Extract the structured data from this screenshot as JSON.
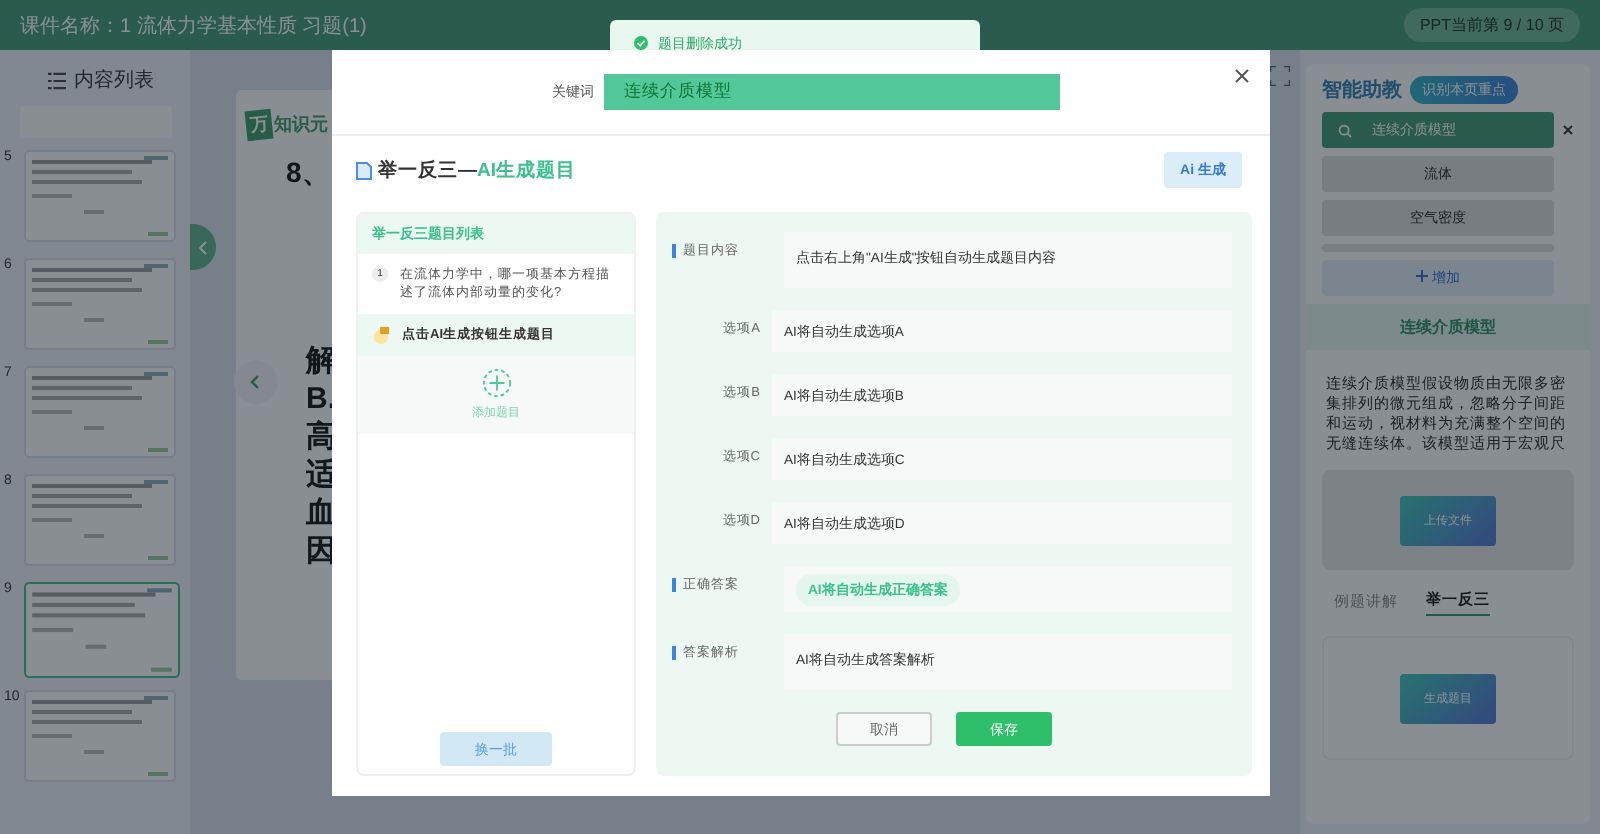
{
  "course_title": "课件名称：1 流体力学基本性质 习题(1)",
  "page_indicator": "PPT当前第 9 / 10 页",
  "content_list": {
    "title": "内容列表",
    "slides": [
      {
        "number": "5",
        "selected": false
      },
      {
        "number": "6",
        "selected": false
      },
      {
        "number": "7",
        "selected": false
      },
      {
        "number": "8",
        "selected": false
      },
      {
        "number": "9",
        "selected": true
      },
      {
        "number": "10",
        "selected": false
      }
    ]
  },
  "slide": {
    "logo_mark": "万",
    "logo_text": "知识元",
    "heading": "8、",
    "lines": [
      "解",
      "B.",
      "高",
      "适",
      "血",
      "因"
    ]
  },
  "assistant": {
    "title": "智能助教",
    "recognize_button": "识别本页重点",
    "search_value": "连续介质模型",
    "keywords": [
      "流体",
      "空气密度"
    ],
    "add_button": "增加",
    "concept_title": "连续介质模型",
    "concept_text": "连续介质模型假设物质由无限多密集排列的微元组成，忽略分子间距和运动，视材料为充满整个空间的无缝连续体。该模型适用于宏观尺",
    "upload_button": "上传文件",
    "tabs": [
      {
        "label": "例题讲解",
        "selected": false
      },
      {
        "label": "举一反三",
        "selected": true
      }
    ],
    "generate_button": "生成题目"
  },
  "toast": {
    "message": "题目删除成功"
  },
  "dialog": {
    "keyword_label": "关键词",
    "keyword_value": "连续介质模型",
    "title": "举一反三—",
    "title_highlight": "AI生成题目",
    "ai_button_mark": "Ai",
    "ai_button": "生成",
    "list_title": "举一反三题目列表",
    "questions": [
      {
        "kind": "numbered",
        "number": "1",
        "text": "在流体力学中，哪一项基本方程描述了流体内部动量的变化?",
        "selected": false
      },
      {
        "kind": "pending",
        "text": "点击AI生成按钮生成题目",
        "selected": true
      }
    ],
    "add_label": "添加题目",
    "refresh_button": "换一批",
    "fields": [
      {
        "label": "题目内容",
        "value": "点击右上角\"AI生成\"按钮自动生成题目内容",
        "marked": true,
        "kind": "tall"
      },
      {
        "label": "选项A",
        "value": "AI将自动生成选项A",
        "marked": false,
        "kind": "line"
      },
      {
        "label": "选项B",
        "value": "AI将自动生成选项B",
        "marked": false,
        "kind": "line"
      },
      {
        "label": "选项C",
        "value": "AI将自动生成选项C",
        "marked": false,
        "kind": "line"
      },
      {
        "label": "选项D",
        "value": "AI将自动生成选项D",
        "marked": false,
        "kind": "line"
      },
      {
        "label": "正确答案",
        "value": "AI将自动生成正确答案",
        "marked": true,
        "kind": "tag"
      },
      {
        "label": "答案解析",
        "value": "AI将自动生成答案解析",
        "marked": true,
        "kind": "tall"
      }
    ],
    "cancel_button": "取消",
    "save_button": "保存"
  }
}
